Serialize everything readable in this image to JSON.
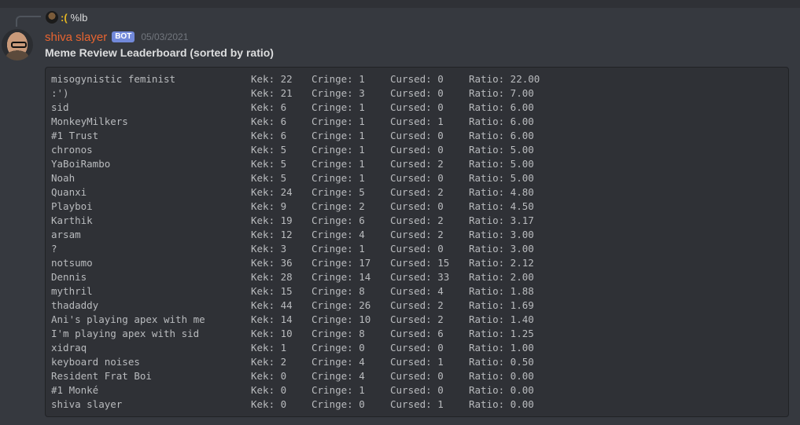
{
  "reply": {
    "name": ":(",
    "text": "%lb"
  },
  "message": {
    "username": "shiva slayer",
    "tag": "BOT",
    "timestamp": "05/03/2021",
    "title": "Meme Review Leaderboard (sorted by ratio)"
  },
  "leaderboard": {
    "rows": [
      {
        "name": "misogynistic feminist",
        "kek": "Kek: 22",
        "cringe": "Cringe: 1",
        "cursed": "Cursed: 0",
        "ratio": "Ratio: 22.00"
      },
      {
        "name": ":')",
        "kek": "Kek: 21",
        "cringe": "Cringe: 3",
        "cursed": "Cursed: 0",
        "ratio": "Ratio: 7.00"
      },
      {
        "name": "sid",
        "kek": "Kek: 6",
        "cringe": "Cringe: 1",
        "cursed": "Cursed: 0",
        "ratio": "Ratio: 6.00"
      },
      {
        "name": "MonkeyMilkers",
        "kek": "Kek: 6",
        "cringe": "Cringe: 1",
        "cursed": "Cursed: 1",
        "ratio": "Ratio: 6.00"
      },
      {
        "name": "#1 Trust",
        "kek": "Kek: 6",
        "cringe": "Cringe: 1",
        "cursed": "Cursed: 0",
        "ratio": "Ratio: 6.00"
      },
      {
        "name": "chronos",
        "kek": "Kek: 5",
        "cringe": "Cringe: 1",
        "cursed": "Cursed: 0",
        "ratio": "Ratio: 5.00"
      },
      {
        "name": "YaBoiRambo",
        "kek": "Kek: 5",
        "cringe": "Cringe: 1",
        "cursed": "Cursed: 2",
        "ratio": "Ratio: 5.00"
      },
      {
        "name": "Noah",
        "kek": "Kek: 5",
        "cringe": "Cringe: 1",
        "cursed": "Cursed: 0",
        "ratio": "Ratio: 5.00"
      },
      {
        "name": "Quanxi",
        "kek": "Kek: 24",
        "cringe": "Cringe: 5",
        "cursed": "Cursed: 2",
        "ratio": "Ratio: 4.80"
      },
      {
        "name": "Playboi",
        "kek": "Kek: 9",
        "cringe": "Cringe: 2",
        "cursed": "Cursed: 0",
        "ratio": "Ratio: 4.50"
      },
      {
        "name": "Karthik",
        "kek": "Kek: 19",
        "cringe": "Cringe: 6",
        "cursed": "Cursed: 2",
        "ratio": "Ratio: 3.17"
      },
      {
        "name": "arsam",
        "kek": "Kek: 12",
        "cringe": "Cringe: 4",
        "cursed": "Cursed: 2",
        "ratio": "Ratio: 3.00"
      },
      {
        "name": "?",
        "kek": "Kek: 3",
        "cringe": "Cringe: 1",
        "cursed": "Cursed: 0",
        "ratio": "Ratio: 3.00"
      },
      {
        "name": "notsumo",
        "kek": "Kek: 36",
        "cringe": "Cringe: 17",
        "cursed": "Cursed: 15",
        "ratio": "Ratio: 2.12"
      },
      {
        "name": "Dennis",
        "kek": "Kek: 28",
        "cringe": "Cringe: 14",
        "cursed": "Cursed: 33",
        "ratio": "Ratio: 2.00"
      },
      {
        "name": "mythril",
        "kek": "Kek: 15",
        "cringe": "Cringe: 8",
        "cursed": "Cursed: 4",
        "ratio": "Ratio: 1.88"
      },
      {
        "name": "thadaddy",
        "kek": "Kek: 44",
        "cringe": "Cringe: 26",
        "cursed": "Cursed: 2",
        "ratio": "Ratio: 1.69"
      },
      {
        "name": "Ani's playing apex with me",
        "kek": "Kek: 14",
        "cringe": "Cringe: 10",
        "cursed": "Cursed: 2",
        "ratio": "Ratio: 1.40"
      },
      {
        "name": "I'm playing apex with sid",
        "kek": "Kek: 10",
        "cringe": "Cringe: 8",
        "cursed": "Cursed: 6",
        "ratio": "Ratio: 1.25"
      },
      {
        "name": "xidraq",
        "kek": "Kek: 1",
        "cringe": "Cringe: 0",
        "cursed": "Cursed: 0",
        "ratio": "Ratio: 1.00"
      },
      {
        "name": "keyboard noises",
        "kek": "Kek: 2",
        "cringe": "Cringe: 4",
        "cursed": "Cursed: 1",
        "ratio": "Ratio: 0.50"
      },
      {
        "name": "Resident Frat Boi",
        "kek": "Kek: 0",
        "cringe": "Cringe: 4",
        "cursed": "Cursed: 0",
        "ratio": "Ratio: 0.00"
      },
      {
        "name": "#1 Monké",
        "kek": "Kek: 0",
        "cringe": "Cringe: 1",
        "cursed": "Cursed: 0",
        "ratio": "Ratio: 0.00"
      },
      {
        "name": "shiva slayer",
        "kek": "Kek: 0",
        "cringe": "Cringe: 0",
        "cursed": "Cursed: 1",
        "ratio": "Ratio: 0.00"
      }
    ]
  }
}
